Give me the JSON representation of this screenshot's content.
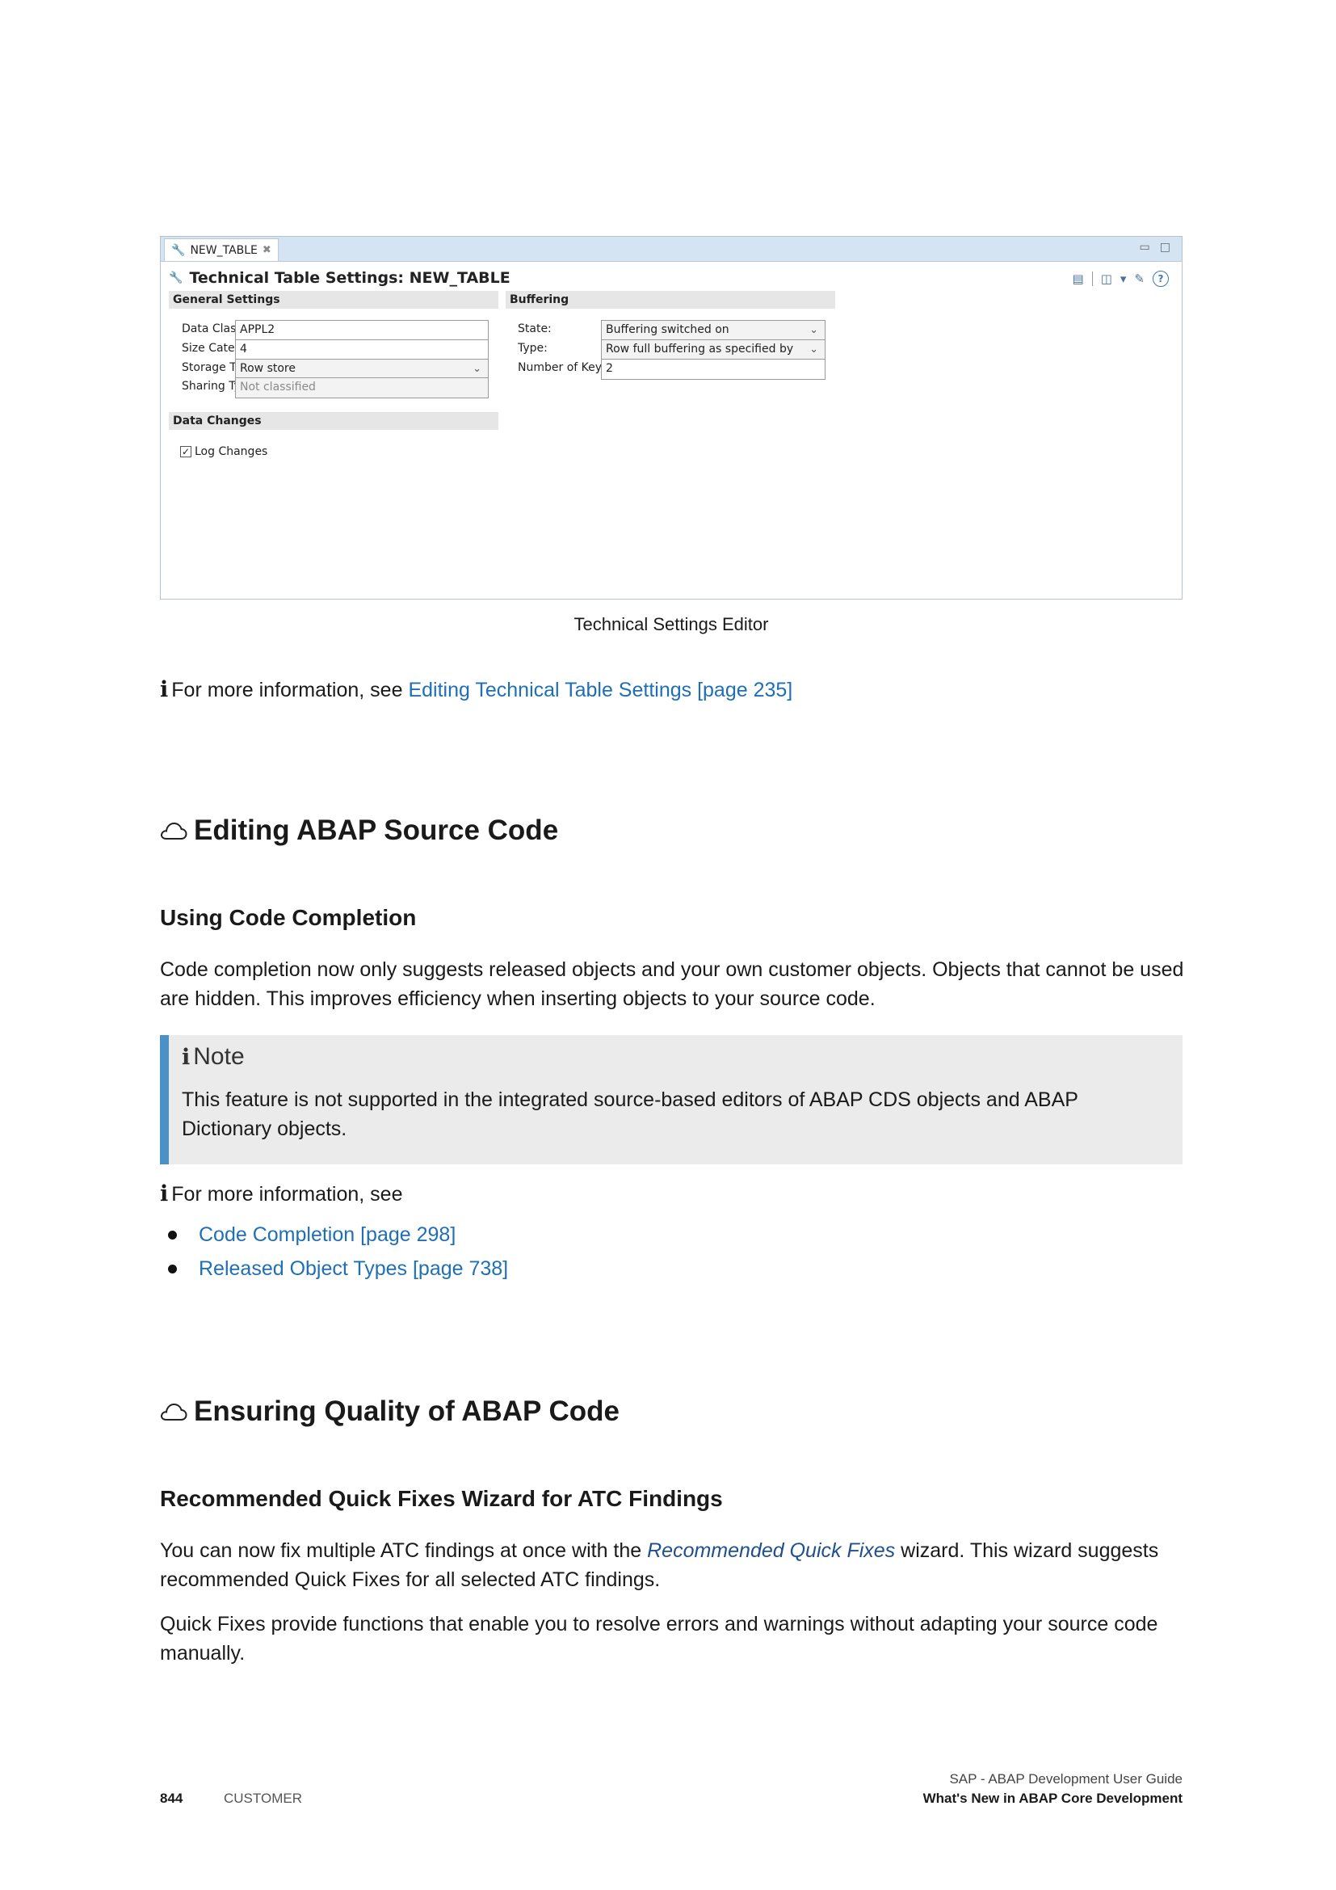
{
  "editor": {
    "tab_label": "NEW_TABLE",
    "title": "Technical Table Settings: NEW_TABLE",
    "general_settings": {
      "heading": "General Settings",
      "data_class_label": "Data Class:",
      "data_class_value": "APPL2",
      "size_category_label": "Size Category:",
      "size_category_value": "4",
      "storage_type_label": "Storage Type:",
      "storage_type_value": "Row store",
      "sharing_type_label": "Sharing Type:",
      "sharing_type_value": "Not classified"
    },
    "buffering": {
      "heading": "Buffering",
      "state_label": "State:",
      "state_value": "Buffering switched on",
      "type_label": "Type:",
      "type_value": "Row full buffering as specified by generic key",
      "key_fields_label": "Number of Key Fields:",
      "key_fields_value": "2"
    },
    "data_changes": {
      "heading": "Data Changes",
      "log_changes_label": "Log Changes",
      "log_changes_checked": true
    }
  },
  "caption": "Technical Settings Editor",
  "info1": {
    "text": "For more information, see ",
    "link": "Editing Technical Table Settings [page 235]"
  },
  "section1": {
    "title": "Editing ABAP Source Code",
    "subtitle": "Using Code Completion",
    "paragraph": "Code completion now only suggests released objects and your own customer objects. Objects that cannot be used are hidden. This improves efficiency when inserting objects to your source code.",
    "note_title": "Note",
    "note_text": "This feature is not supported in the integrated source-based editors of ABAP CDS objects and ABAP Dictionary objects.",
    "info_text": "For more information, see",
    "links": [
      "Code Completion [page 298]",
      "Released Object Types [page 738]"
    ]
  },
  "section2": {
    "title": "Ensuring Quality of ABAP Code",
    "subtitle": "Recommended Quick Fixes Wizard for ATC Findings",
    "p1_before": "You can now fix multiple ATC findings at once with the ",
    "p1_link": "Recommended Quick Fixes",
    "p1_after": " wizard. This wizard suggests recommended Quick Fixes for all selected ATC findings.",
    "p2": "Quick Fixes provide functions that enable you to resolve errors and warnings without adapting your source code manually."
  },
  "footer": {
    "page_number": "844",
    "audience": "CUSTOMER",
    "guide_title": "SAP - ABAP Development User Guide",
    "section_title": "What's New in ABAP Core Development"
  },
  "icons": {
    "info": "info-i-icon",
    "section": "cloud-icon",
    "wrench": "wrench-icon",
    "help": "help-icon"
  }
}
